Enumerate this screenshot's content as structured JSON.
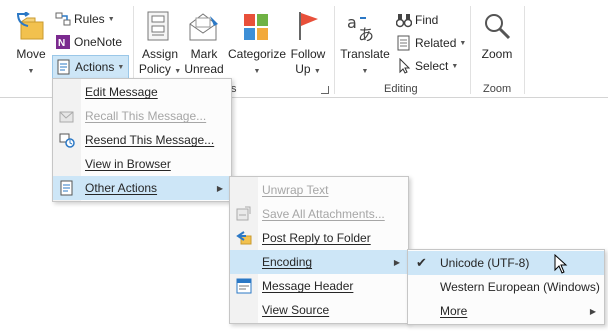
{
  "ribbon": {
    "move": {
      "label": "Move",
      "rules": "Rules",
      "onenote": "OneNote",
      "actions": "Actions"
    },
    "tags": {
      "assign_policy_1": "Assign",
      "assign_policy_2": "Policy",
      "mark_unread_1": "Mark",
      "mark_unread_2": "Unread",
      "categorize": "Categorize",
      "follow_up_1": "Follow",
      "follow_up_2": "Up",
      "group_label_tail": "s"
    },
    "editing": {
      "translate": "Translate",
      "find": "Find",
      "related": "Related",
      "select": "Select",
      "group_label": "Editing"
    },
    "zoom": {
      "label": "Zoom",
      "group_label": "Zoom"
    }
  },
  "actions_menu": {
    "items": [
      {
        "label": "Edit Message",
        "enabled": true
      },
      {
        "label": "Recall This Message...",
        "enabled": false
      },
      {
        "label": "Resend This Message...",
        "enabled": true
      },
      {
        "label": "View in Browser",
        "enabled": true
      },
      {
        "label": "Other Actions",
        "enabled": true,
        "submenu": true,
        "highlighted": true
      }
    ]
  },
  "other_actions_menu": {
    "items": [
      {
        "label": "Unwrap Text",
        "enabled": false
      },
      {
        "label": "Save All Attachments...",
        "enabled": false
      },
      {
        "label": "Post Reply to Folder",
        "enabled": true
      },
      {
        "label": "Encoding",
        "enabled": true,
        "submenu": true,
        "highlighted": true
      },
      {
        "label": "Message Header",
        "enabled": true
      },
      {
        "label": "View Source",
        "enabled": true
      }
    ]
  },
  "encoding_menu": {
    "items": [
      {
        "label": "Unicode (UTF-8)",
        "checked": true,
        "highlighted": true
      },
      {
        "label": "Western European (Windows)",
        "checked": false
      },
      {
        "label": "More",
        "submenu": true
      }
    ]
  },
  "colors": {
    "highlight": "#cde6f7",
    "accent_blue": "#2b78c5",
    "flag_red": "#e8503a"
  }
}
